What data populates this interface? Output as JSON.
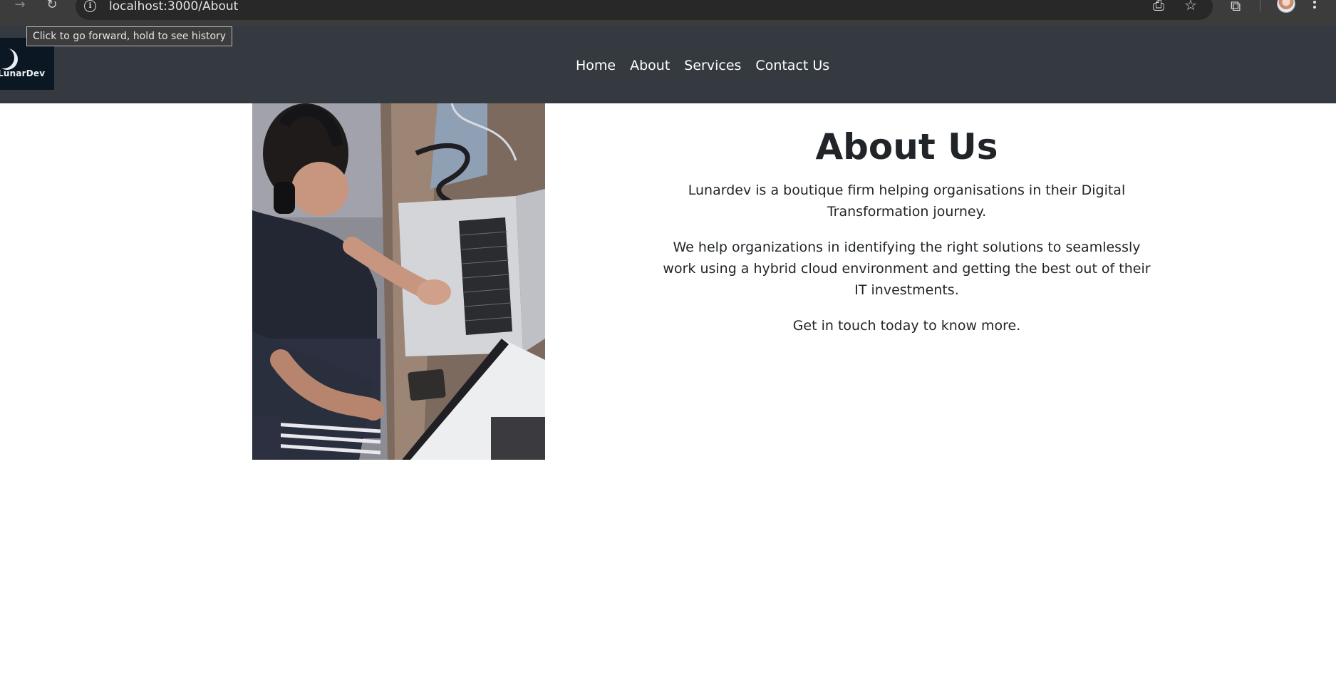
{
  "browser": {
    "url": "localhost:3000/About",
    "tooltip": "Click to go forward, hold to see history",
    "icons": [
      "back-arrow-icon",
      "forward-arrow-icon",
      "reload-icon",
      "site-info-icon",
      "install-app-icon",
      "bookmark-star-icon",
      "extensions-icon",
      "profile-avatar",
      "menu-dots-icon"
    ]
  },
  "site": {
    "logo_text": "LunarDev",
    "nav": {
      "items": [
        {
          "label": "Home"
        },
        {
          "label": "About"
        },
        {
          "label": "Services"
        },
        {
          "label": "Contact Us"
        }
      ]
    }
  },
  "about": {
    "heading": "About Us",
    "paragraphs": [
      "Lunardev is a boutique firm helping organisations in their Digital Transformation journey.",
      "We help organizations in identifying the right solutions to seamlessly work using a hybrid cloud environment and getting the best out of their IT investments.",
      "Get in touch today to know more."
    ]
  },
  "colors": {
    "navbar_bg": "#343a40",
    "chrome_bg": "#3c3c3c",
    "text": "#212529"
  }
}
